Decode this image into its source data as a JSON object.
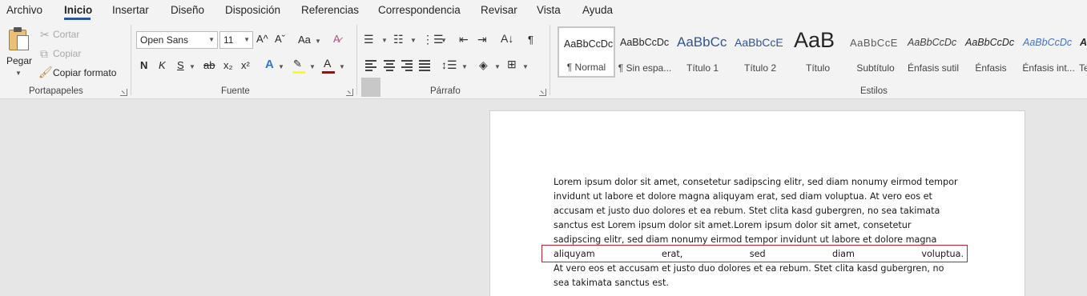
{
  "menu": {
    "tabs": [
      "Archivo",
      "Inicio",
      "Insertar",
      "Diseño",
      "Disposición",
      "Referencias",
      "Correspondencia",
      "Revisar",
      "Vista",
      "Ayuda"
    ],
    "active_tab": "Inicio"
  },
  "clipboard": {
    "paste_label": "Pegar",
    "cut_label": "Cortar",
    "copy_label": "Copiar",
    "format_painter_label": "Copiar formato",
    "group_label": "Portapapeles"
  },
  "font": {
    "font_name": "Open Sans",
    "font_size": "11",
    "group_label": "Fuente",
    "bold": "N",
    "italic": "K",
    "underline": "S",
    "strikethrough": "ab",
    "subscript": "x₂",
    "superscript": "x²",
    "grow": "A^",
    "shrink": "Aˇ",
    "change_case": "Aa",
    "highlight_color": "#ffff00",
    "font_color": "#c00000",
    "effects_color": "#2b79d8"
  },
  "paragraph": {
    "group_label": "Párrafo",
    "pilcrow": "¶"
  },
  "styles": {
    "group_label": "Estilos",
    "items": [
      {
        "sample": "AaBbCcDc",
        "name": "¶ Normal"
      },
      {
        "sample": "AaBbCcDc",
        "name": "¶ Sin espa..."
      },
      {
        "sample": "AaBbCc",
        "name": "Título 1"
      },
      {
        "sample": "AaBbCcE",
        "name": "Título 2"
      },
      {
        "sample": "AaB",
        "name": "Título"
      },
      {
        "sample": "AaBbCcE",
        "name": "Subtítulo"
      },
      {
        "sample": "AaBbCcDc",
        "name": "Énfasis sutil"
      },
      {
        "sample": "AaBbCcDc",
        "name": "Énfasis"
      },
      {
        "sample": "AaBbCcDc",
        "name": "Énfasis int..."
      },
      {
        "sample": "A",
        "name": "Te"
      }
    ]
  },
  "document": {
    "lines": [
      "Lorem ipsum dolor sit amet, consetetur sadipscing elitr, sed diam nonumy eirmod tempor",
      "invidunt ut labore et dolore magna aliquyam erat, sed diam voluptua. At vero eos et",
      "accusam et justo duo dolores et ea rebum. Stet clita kasd gubergren, no sea takimata",
      "sanctus est Lorem ipsum dolor sit amet.Lorem ipsum dolor sit amet, consetetur",
      "sadipscing elitr, sed diam nonumy eirmod tempor invidunt ut labore et dolore magna"
    ],
    "stretched_line_words": [
      "aliquyam",
      "erat,",
      "sed",
      "diam",
      "voluptua."
    ],
    "after_lines": [
      "At vero eos et accusam et justo duo dolores et ea rebum.  Stet clita kasd gubergren, no",
      "sea takimata sanctus est."
    ],
    "highlight_color": "#c0232a"
  }
}
